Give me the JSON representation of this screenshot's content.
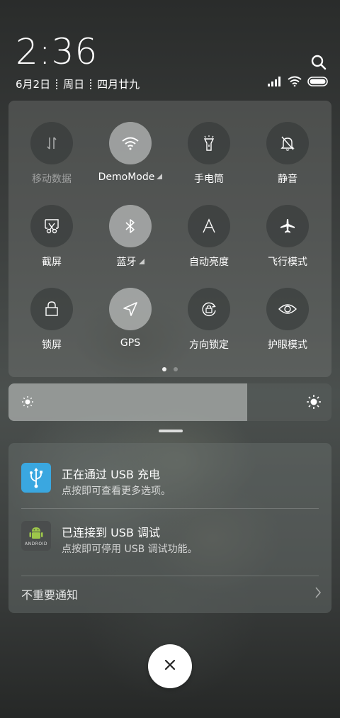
{
  "status": {
    "time": "2:36",
    "date_parts": [
      "6月2日",
      "周日",
      "四月廿九"
    ]
  },
  "toggles": [
    {
      "label": "移动数据",
      "icon": "mobile-data-icon",
      "on": false,
      "disabled": true
    },
    {
      "label": "DemoMode",
      "icon": "wifi-icon",
      "on": true,
      "has_more": true
    },
    {
      "label": "手电筒",
      "icon": "flashlight-icon",
      "on": false
    },
    {
      "label": "静音",
      "icon": "mute-icon",
      "on": false
    },
    {
      "label": "截屏",
      "icon": "screenshot-icon",
      "on": false
    },
    {
      "label": "蓝牙",
      "icon": "bluetooth-icon",
      "on": true,
      "has_more": true
    },
    {
      "label": "自动亮度",
      "icon": "auto-brightness-icon",
      "on": false
    },
    {
      "label": "飞行模式",
      "icon": "airplane-icon",
      "on": false
    },
    {
      "label": "锁屏",
      "icon": "lock-icon",
      "on": false
    },
    {
      "label": "GPS",
      "icon": "gps-icon",
      "on": true
    },
    {
      "label": "方向锁定",
      "icon": "rotation-lock-icon",
      "on": false
    },
    {
      "label": "护眼模式",
      "icon": "eye-icon",
      "on": false
    }
  ],
  "pager": {
    "pages": 2,
    "current": 1
  },
  "brightness": {
    "level": 0.74
  },
  "notifications": [
    {
      "title": "正在通过 USB 充电",
      "subtitle": "点按即可查看更多选项。",
      "icon": "usb-icon",
      "color": "#3aa7e0"
    },
    {
      "title": "已连接到 USB 调试",
      "subtitle": "点按即可停用 USB 调试功能。",
      "icon": "android-icon",
      "color": "#4a4d4d",
      "icon_text": "ANDROID"
    }
  ],
  "unimportant_label": "不重要通知",
  "colors": {
    "usb_blue": "#3aa7e0",
    "android_green": "#9dc74a"
  }
}
